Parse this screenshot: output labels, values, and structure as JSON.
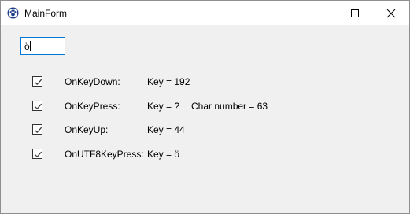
{
  "window": {
    "title": "MainForm",
    "icon": "paw-icon",
    "controls": [
      "minimize-icon",
      "maximize-icon",
      "close-icon"
    ]
  },
  "edit": {
    "value": "ö"
  },
  "rows": [
    {
      "checked": true,
      "label": "OnKeyDown:",
      "value": "Key = 192",
      "extra": ""
    },
    {
      "checked": true,
      "label": "OnKeyPress:",
      "value": "Key = ?",
      "extra": "Char number = 63"
    },
    {
      "checked": true,
      "label": "OnKeyUp:",
      "value": "Key = 44",
      "extra": ""
    },
    {
      "checked": true,
      "label": "OnUTF8KeyPress:",
      "value": "Key = ö",
      "extra": ""
    }
  ]
}
